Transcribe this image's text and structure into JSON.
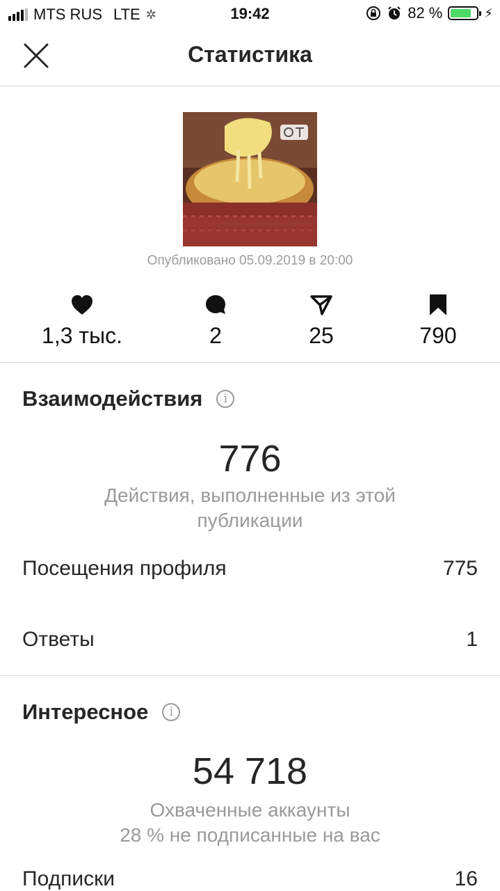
{
  "status_bar": {
    "carrier": "MTS RUS",
    "network": "LTE",
    "time": "19:42",
    "battery": "82 %",
    "battery_level": 0.82
  },
  "header": {
    "title": "Статистика"
  },
  "post": {
    "published": "Опубликовано 05.09.2019 в 20:00",
    "thumbnail_icon": "food-photo"
  },
  "stats": [
    {
      "icon": "heart-icon",
      "value": "1,3 тыс."
    },
    {
      "icon": "comment-icon",
      "value": "2"
    },
    {
      "icon": "share-icon",
      "value": "25"
    },
    {
      "icon": "bookmark-icon",
      "value": "790"
    }
  ],
  "interactions": {
    "title": "Взаимодействия",
    "total": "776",
    "caption": "Действия, выполненные из этой публикации",
    "rows": [
      {
        "label": "Посещения профиля",
        "value": "775"
      },
      {
        "label": "Ответы",
        "value": "1"
      }
    ]
  },
  "discovery": {
    "title": "Интересное",
    "total": "54 718",
    "caption_line1": "Охваченные аккаунты",
    "caption_line2": "28 % не подписанные на вас",
    "rows": [
      {
        "label": "Подписки",
        "value": "16"
      }
    ]
  },
  "colors": {
    "text": "#262626",
    "secondary": "#9a9a9a",
    "divider": "#d8d8d8",
    "battery": "#4cd964"
  }
}
